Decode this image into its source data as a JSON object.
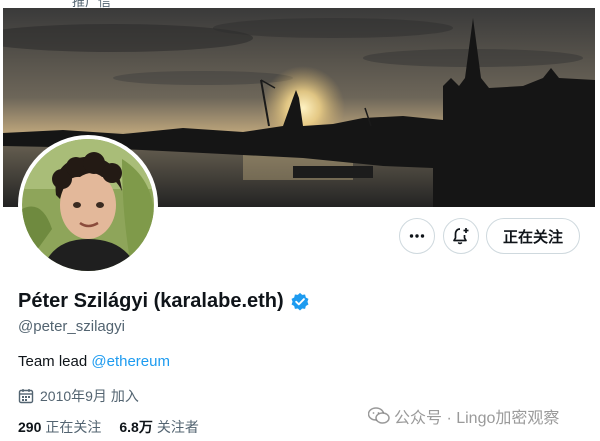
{
  "top_strip": {
    "partial_text": "推广信"
  },
  "profile": {
    "display_name": "Péter Szilágyi (karalabe.eth)",
    "handle": "@peter_szilagyi",
    "bio_text": "Team lead ",
    "bio_link": "@ethereum",
    "joined": "2010年9月 加入",
    "following_count": "290",
    "following_label": "正在关注",
    "followers_count": "6.8万",
    "followers_label": "关注者"
  },
  "actions": {
    "more_icon": "more-icon",
    "notify_icon": "bell-plus-icon",
    "follow_label": "正在关注"
  },
  "watermark": {
    "text": "公众号 · Lingo加密观察"
  },
  "colors": {
    "verified": "#1d9bf0",
    "link": "#1d9bf0",
    "secondary_text": "#536471",
    "primary_text": "#0f1419"
  }
}
